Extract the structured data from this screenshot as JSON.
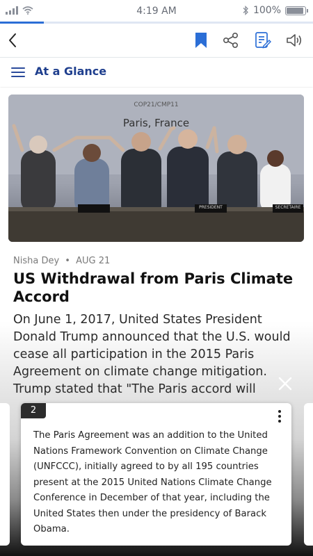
{
  "status": {
    "time": "4:19 AM",
    "battery": "100%",
    "battery_level": 1.0,
    "reading_progress": 0.14
  },
  "subheader": {
    "title": "At a Glance"
  },
  "article": {
    "image": {
      "sign_top": "COP21/CMP11",
      "sign_main": "Paris, France",
      "plaque_1": "PRESIDENT",
      "plaque_2": "SECRETAIRE"
    },
    "author": "Nisha Dey",
    "separator": "•",
    "date": "AUG 21",
    "title": "US Withdrawal from Paris Climate Accord",
    "body": "On June 1, 2017, United States President Donald Trump announced that the U.S. would cease all participation in the 2015 Paris Agreement on climate change mitigation. Trump stated that \"The Paris accord will"
  },
  "popup": {
    "number": "2",
    "text": "The Paris Agreement was an addition to the United Nations Framework Convention on Climate Change (UNFCCC), initially agreed to by all 195 countries present at the 2015 United Nations Climate Change Conference in December of that year, including the United States then under the presidency of Barack Obama."
  },
  "colors": {
    "accent": "#2b6ed6",
    "nav_text": "#1f3f8e"
  }
}
